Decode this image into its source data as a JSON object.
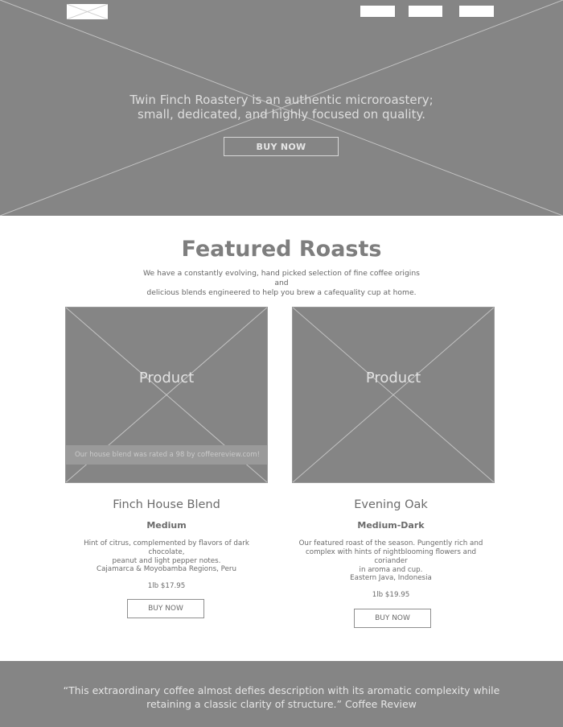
{
  "hero": {
    "tagline_line1": "Twin Finch Roastery is an authentic microroastery;",
    "tagline_line2": "small, dedicated, and highly focused on quality.",
    "buy_label": "BUY NOW"
  },
  "featured": {
    "title": "Featured Roasts",
    "subtitle_line1": "We have a constantly evolving, hand picked selection of fine coffee origins and",
    "subtitle_line2": "delicious blends engineered to help you brew a cafequality cup at home."
  },
  "products": [
    {
      "image_label": "Product",
      "overlay": "Our house blend was rated a 98 by coffeereview.com!",
      "name": "Finch House Blend",
      "roast": "Medium",
      "desc_line1": "Hint of citrus,  complemented by flavors of dark chocolate,",
      "desc_line2": "peanut and light pepper notes.",
      "region": "Cajamarca & Moyobamba Regions, Peru",
      "price": "1lb $17.95",
      "buy_label": "BUY NOW"
    },
    {
      "image_label": "Product",
      "name": "Evening Oak",
      "roast": "Medium-Dark",
      "desc_line1": "Our featured roast of the season. Pungently rich and",
      "desc_line2": "complex with hints of nightblooming flowers and coriander",
      "desc_line3": "in aroma and cup.",
      "region": "Eastern Java, Indonesia",
      "price": "1lb $19.95",
      "buy_label": "BUY NOW"
    }
  ],
  "quote": {
    "line1": "“This extraordinary coffee almost defies description with its aromatic complexity while",
    "line2": "retaining a classic clarity of structure.”  Coffee Review"
  }
}
